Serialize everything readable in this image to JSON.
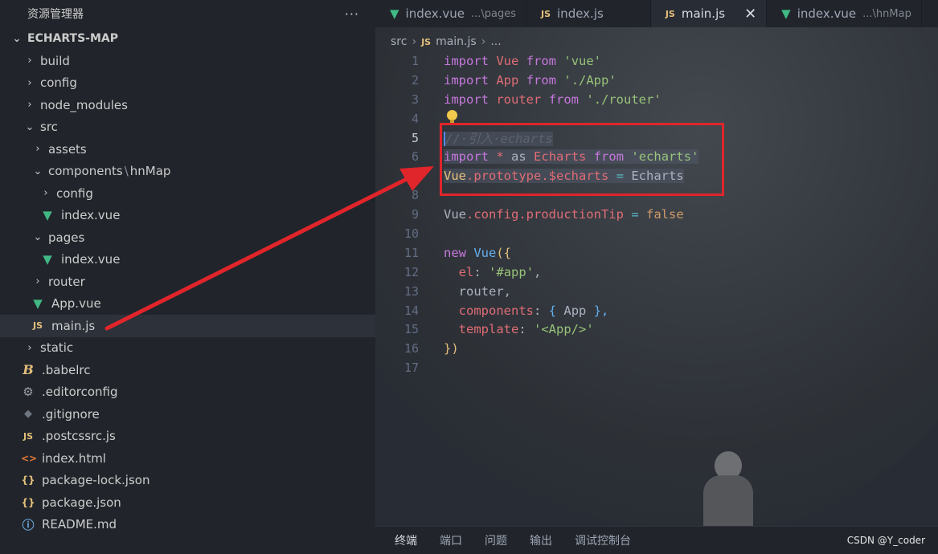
{
  "explorer": {
    "title": "资源管理器",
    "more": "···",
    "root": "ECHARTS-MAP",
    "items": [
      {
        "label": "build",
        "icon": "chevron-right-icon"
      },
      {
        "label": "config",
        "icon": "chevron-right-icon"
      },
      {
        "label": "node_modules",
        "icon": "chevron-right-icon"
      },
      {
        "label": "src",
        "icon": "chevron-down-icon"
      },
      {
        "label": "assets",
        "icon": "chevron-right-icon"
      },
      {
        "label": "components",
        "sep": "\\",
        "label2": "hnMap",
        "icon": "chevron-down-icon"
      },
      {
        "label": "config",
        "icon": "chevron-right-icon"
      },
      {
        "label": "index.vue",
        "icon": "vue-icon"
      },
      {
        "label": "pages",
        "icon": "chevron-down-icon"
      },
      {
        "label": "index.vue",
        "icon": "vue-icon"
      },
      {
        "label": "router",
        "icon": "chevron-right-icon"
      },
      {
        "label": "App.vue",
        "icon": "vue-icon"
      },
      {
        "label": "main.js",
        "icon": "js-icon",
        "badge": "JS"
      },
      {
        "label": "static",
        "icon": "chevron-right-icon"
      },
      {
        "label": ".babelrc",
        "icon": "babel-icon"
      },
      {
        "label": ".editorconfig",
        "icon": "gear-icon"
      },
      {
        "label": ".gitignore",
        "icon": "git-icon"
      },
      {
        "label": ".postcssrc.js",
        "icon": "js-icon",
        "badge": "JS"
      },
      {
        "label": "index.html",
        "icon": "html-icon",
        "badge": "<>"
      },
      {
        "label": "package-lock.json",
        "icon": "json-icon",
        "badge": "{}"
      },
      {
        "label": "package.json",
        "icon": "json-icon",
        "badge": "{}"
      },
      {
        "label": "README.md",
        "icon": "info-icon"
      }
    ]
  },
  "tabs": [
    {
      "label": "index.vue",
      "hint": "...\\pages"
    },
    {
      "label": "index.js",
      "badge": "JS"
    },
    {
      "label": "main.js",
      "badge": "JS",
      "close": "✕"
    },
    {
      "label": "index.vue",
      "hint": "...\\hnMap"
    }
  ],
  "breadcrumb": {
    "part1": "src",
    "badge": "JS",
    "part2": "main.js",
    "part3": "..."
  },
  "code": {
    "line_numbers": [
      "1",
      "2",
      "3",
      "4",
      "5",
      "6",
      "7",
      "8",
      "9",
      "10",
      "11",
      "12",
      "13",
      "14",
      "15",
      "16",
      "17"
    ],
    "l1": {
      "a": "import",
      "b": "Vue",
      "c": "from",
      "d": "'vue'"
    },
    "l2": {
      "a": "import",
      "b": "App",
      "c": "from",
      "d": "'./App'"
    },
    "l3": {
      "a": "import",
      "b": "router",
      "c": "from",
      "d": "'./router'"
    },
    "l5": {
      "a": "//·引入·echarts"
    },
    "l6": {
      "a": "import",
      "b": "*",
      "c": "as",
      "d": "Echarts",
      "e": "from",
      "f": "'echarts'"
    },
    "l7": {
      "a": "Vue",
      "b": ".prototype.",
      "c": "$echarts",
      "d": "=",
      "e": "Echarts"
    },
    "l9": {
      "a": "Vue",
      "b": ".config.",
      "c": "productionTip",
      "d": "=",
      "e": "false"
    },
    "l11": {
      "a": "new",
      "b": "Vue",
      "c": "({"
    },
    "l12": {
      "a": "el",
      "b": ":",
      "c": "'#app'",
      "d": ","
    },
    "l13": {
      "a": "router,"
    },
    "l14": {
      "a": "components",
      "b": ":",
      "c": "{",
      "d": "App",
      "e": "},"
    },
    "l15": {
      "a": "template",
      "b": ":",
      "c": "'<App/>'"
    },
    "l16": {
      "a": "})"
    }
  },
  "panel": {
    "tabs": [
      "终端",
      "端口",
      "问题",
      "输出",
      "调试控制台"
    ]
  },
  "watermark": "CSDN @Y_coder",
  "colors": {
    "highlight_box": "#e0252b",
    "arrow": "#e0252b",
    "vue": "#41b883",
    "js": "#e5c07b"
  }
}
